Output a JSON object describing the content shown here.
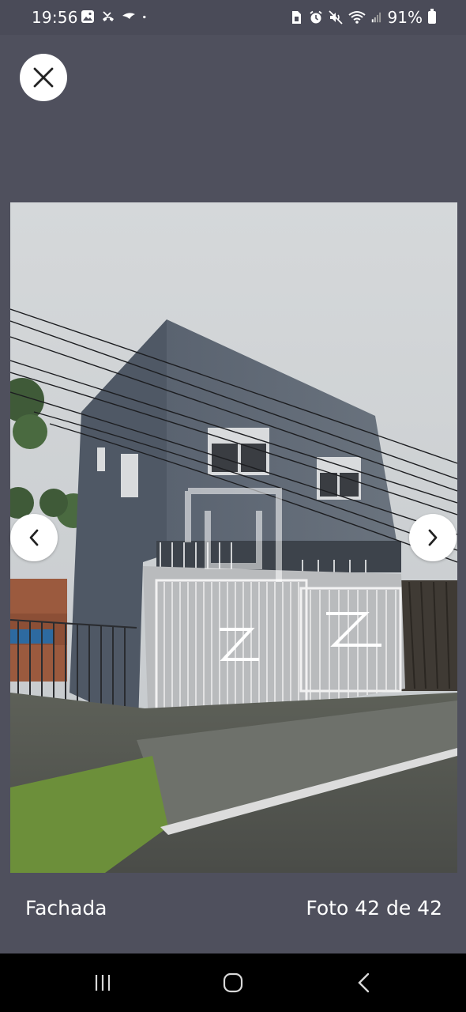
{
  "status_bar": {
    "time": "19:56",
    "battery": "91%",
    "icons": [
      "gallery-icon",
      "missed-call-icon",
      "bird-app-icon",
      "notification-dot-icon",
      "sim-icon",
      "alarm-icon",
      "mute-icon",
      "wifi-icon",
      "signal-icon",
      "battery-icon"
    ]
  },
  "viewer": {
    "caption": "Fachada",
    "counter": "Foto 42 de 42",
    "close_icon": "close-icon",
    "prev_icon": "chevron-left-icon",
    "next_icon": "chevron-right-icon"
  },
  "system_nav": {
    "icons": [
      "recents-icon",
      "home-icon",
      "back-icon"
    ]
  },
  "colors": {
    "background": "#4f505d",
    "status_bar": "#4a4b58",
    "system_nav": "#000000",
    "text": "#ffffff"
  }
}
